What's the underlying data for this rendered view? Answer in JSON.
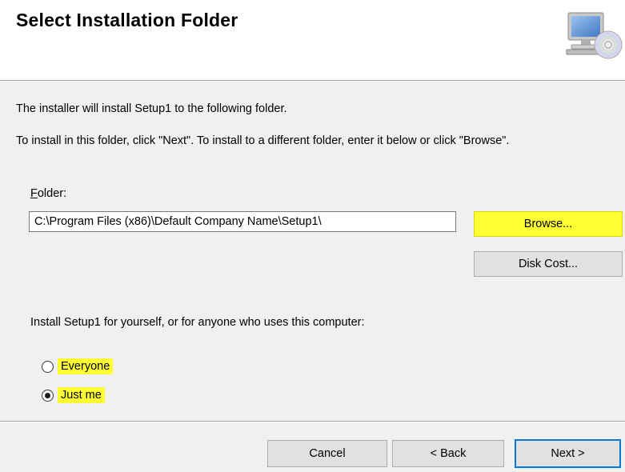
{
  "header": {
    "title": "Select Installation Folder",
    "icon": "computer-cd-icon"
  },
  "body": {
    "intro_line1": "The installer will install Setup1 to the following folder.",
    "intro_line2": "To install in this folder, click \"Next\". To install to a different folder, enter it below or click \"Browse\".",
    "folder_label_accel": "F",
    "folder_label_rest": "older:",
    "folder_value": "C:\\Program Files (x86)\\Default Company Name\\Setup1\\",
    "browse_label": "Browse...",
    "disk_cost_label": "Disk Cost...",
    "install_for_question": "Install Setup1 for yourself, or for anyone who uses this computer:",
    "options": [
      {
        "label": "Everyone",
        "selected": false
      },
      {
        "label": "Just me",
        "selected": true
      }
    ]
  },
  "footer": {
    "cancel_label": "Cancel",
    "back_label": "< Back",
    "next_label": "Next >"
  },
  "colors": {
    "highlight": "#ffff33",
    "dialog_bg": "#f0f0f0",
    "default_button_border": "#0078d7"
  }
}
